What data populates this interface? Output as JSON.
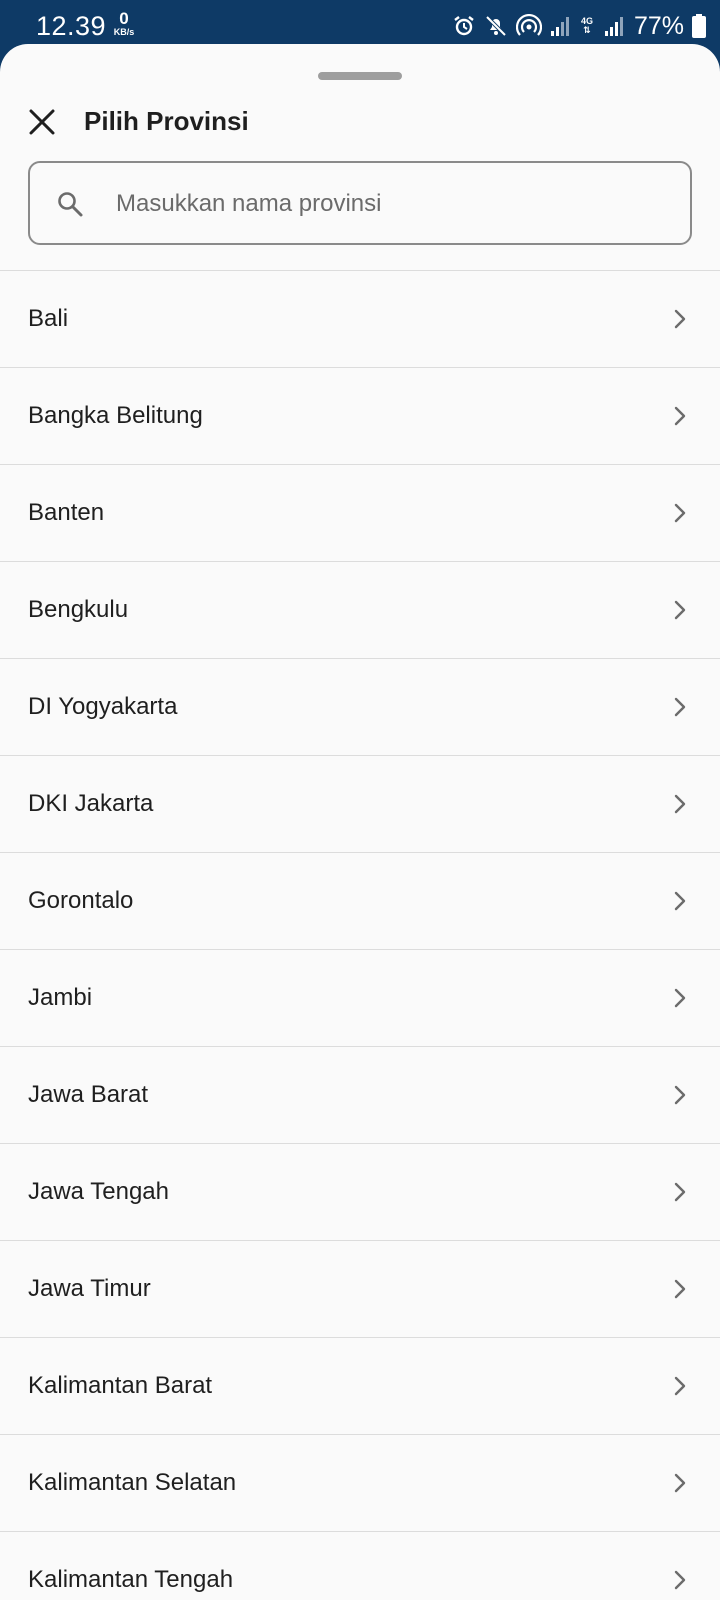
{
  "status_bar": {
    "time": "12.39",
    "speed_value": "0",
    "speed_unit": "KB/s",
    "network_type": "4G",
    "battery_percent": "77%",
    "icons": [
      "alarm-icon",
      "mute-icon",
      "hotspot-icon",
      "signal-icon",
      "signal-icon",
      "battery-icon"
    ]
  },
  "sheet": {
    "title": "Pilih Provinsi",
    "close_icon": "close-icon",
    "search": {
      "placeholder": "Masukkan nama provinsi",
      "value": "",
      "icon": "search-icon"
    },
    "provinces": [
      {
        "label": "Bali"
      },
      {
        "label": "Bangka Belitung"
      },
      {
        "label": "Banten"
      },
      {
        "label": "Bengkulu"
      },
      {
        "label": "DI Yogyakarta"
      },
      {
        "label": "DKI Jakarta"
      },
      {
        "label": "Gorontalo"
      },
      {
        "label": "Jambi"
      },
      {
        "label": "Jawa Barat"
      },
      {
        "label": "Jawa Tengah"
      },
      {
        "label": "Jawa Timur"
      },
      {
        "label": "Kalimantan Barat"
      },
      {
        "label": "Kalimantan Selatan"
      },
      {
        "label": "Kalimantan Tengah"
      }
    ]
  },
  "colors": {
    "status_bar_bg": "#0e3a66",
    "sheet_bg": "#fafafa",
    "divider": "#dcdcdc",
    "text_primary": "#1f1f1f",
    "placeholder": "#6b6b6b"
  }
}
